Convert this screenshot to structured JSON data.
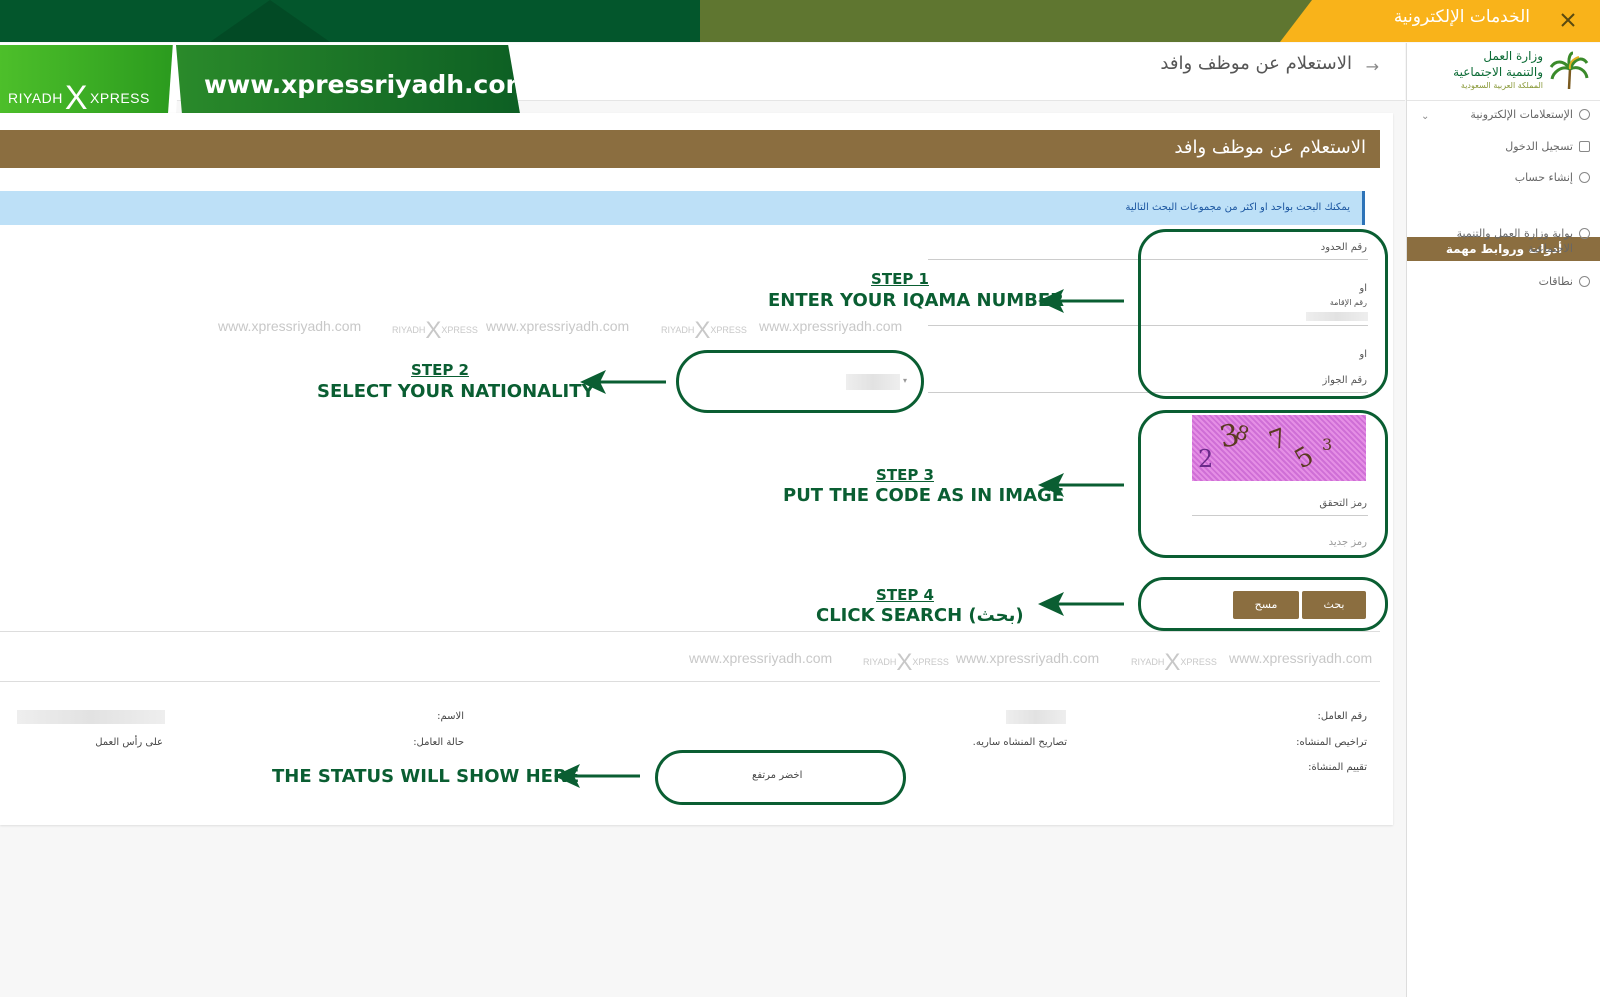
{
  "topbar": {
    "title": "الخدمات الإلكترونية",
    "close_icon": "close-icon",
    "colors": {
      "green": "#03562c",
      "olive": "#5f7630",
      "gold": "#f9b31a"
    }
  },
  "sidebar": {
    "logo": {
      "line1": "وزارة العمل",
      "line2": "والتنمية الاجتماعية",
      "line3": "المملكة العربية السعودية",
      "icon": "palm-tree-icon"
    },
    "items": [
      {
        "label": "الإستعلامات الإلكترونية",
        "icon": "gears-icon"
      },
      {
        "label": "تسجيل الدخول",
        "icon": "login-icon"
      },
      {
        "label": "إنشاء حساب",
        "icon": "plus-circle-icon"
      }
    ],
    "section_header": "أدوات وروابط مهمة",
    "links": [
      {
        "label": "بوابة وزارة العمل والتنمية الاجتماعية",
        "icon": "globe-icon"
      },
      {
        "label": "نطاقات",
        "icon": "plus-circle-icon"
      }
    ]
  },
  "header": {
    "title": "الاستعلام عن موظف وافد",
    "back_icon": "arrow-right-icon"
  },
  "banner": {
    "brand": "RIYADH",
    "brand_x": "X",
    "brand_suffix": "XPRESS",
    "url": "www.xpressriyadh.com"
  },
  "content": {
    "title": "الاستعلام عن موظف وافد",
    "info": "يمكنك البحث بواحد او اكثر من مجموعات البحث التالية",
    "fields": {
      "border_number": "رقم الحدود",
      "or1": "او",
      "iqama_number": "رقم الإقامة",
      "or2": "او",
      "passport_number": "رقم الجواز",
      "captcha_label": "رمز التحقق",
      "new_code": "رمز جديد"
    },
    "captcha_chars": [
      "2",
      "3",
      "8",
      "7",
      "5",
      "3"
    ],
    "buttons": {
      "search": "بحث",
      "clear": "مسح"
    },
    "results": {
      "worker_number": "رقم العامل:",
      "name": "الاسم:",
      "establishment_licenses": "تراخيص المنشاه:",
      "establishment_permits_value": "تصاريح المنشاه ساريه.",
      "worker_status": "حالة العامل:",
      "worker_status_value": "على رأس العمل",
      "establishment_rating": "تقييم المنشاة:",
      "rating_value": "اخضر مرتفع"
    }
  },
  "steps": [
    {
      "title": "STEP 1",
      "desc": "ENTER YOUR IQAMA NUMBER"
    },
    {
      "title": "STEP 2",
      "desc": "SELECT YOUR NATIONALITY"
    },
    {
      "title": "STEP 3",
      "desc": "PUT THE CODE AS IN IMAGE"
    },
    {
      "title": "STEP 4",
      "desc": "CLICK SEARCH (بحث)"
    }
  ],
  "status_note": "THE STATUS WILL SHOW HERE",
  "watermark": {
    "url": "www.xpressriyadh.com",
    "logo_left": "RIYADH",
    "logo_x": "X",
    "logo_right": "XPRESS"
  },
  "annotation_color": "#0a5e32",
  "brand_brown": "#8b6e40"
}
